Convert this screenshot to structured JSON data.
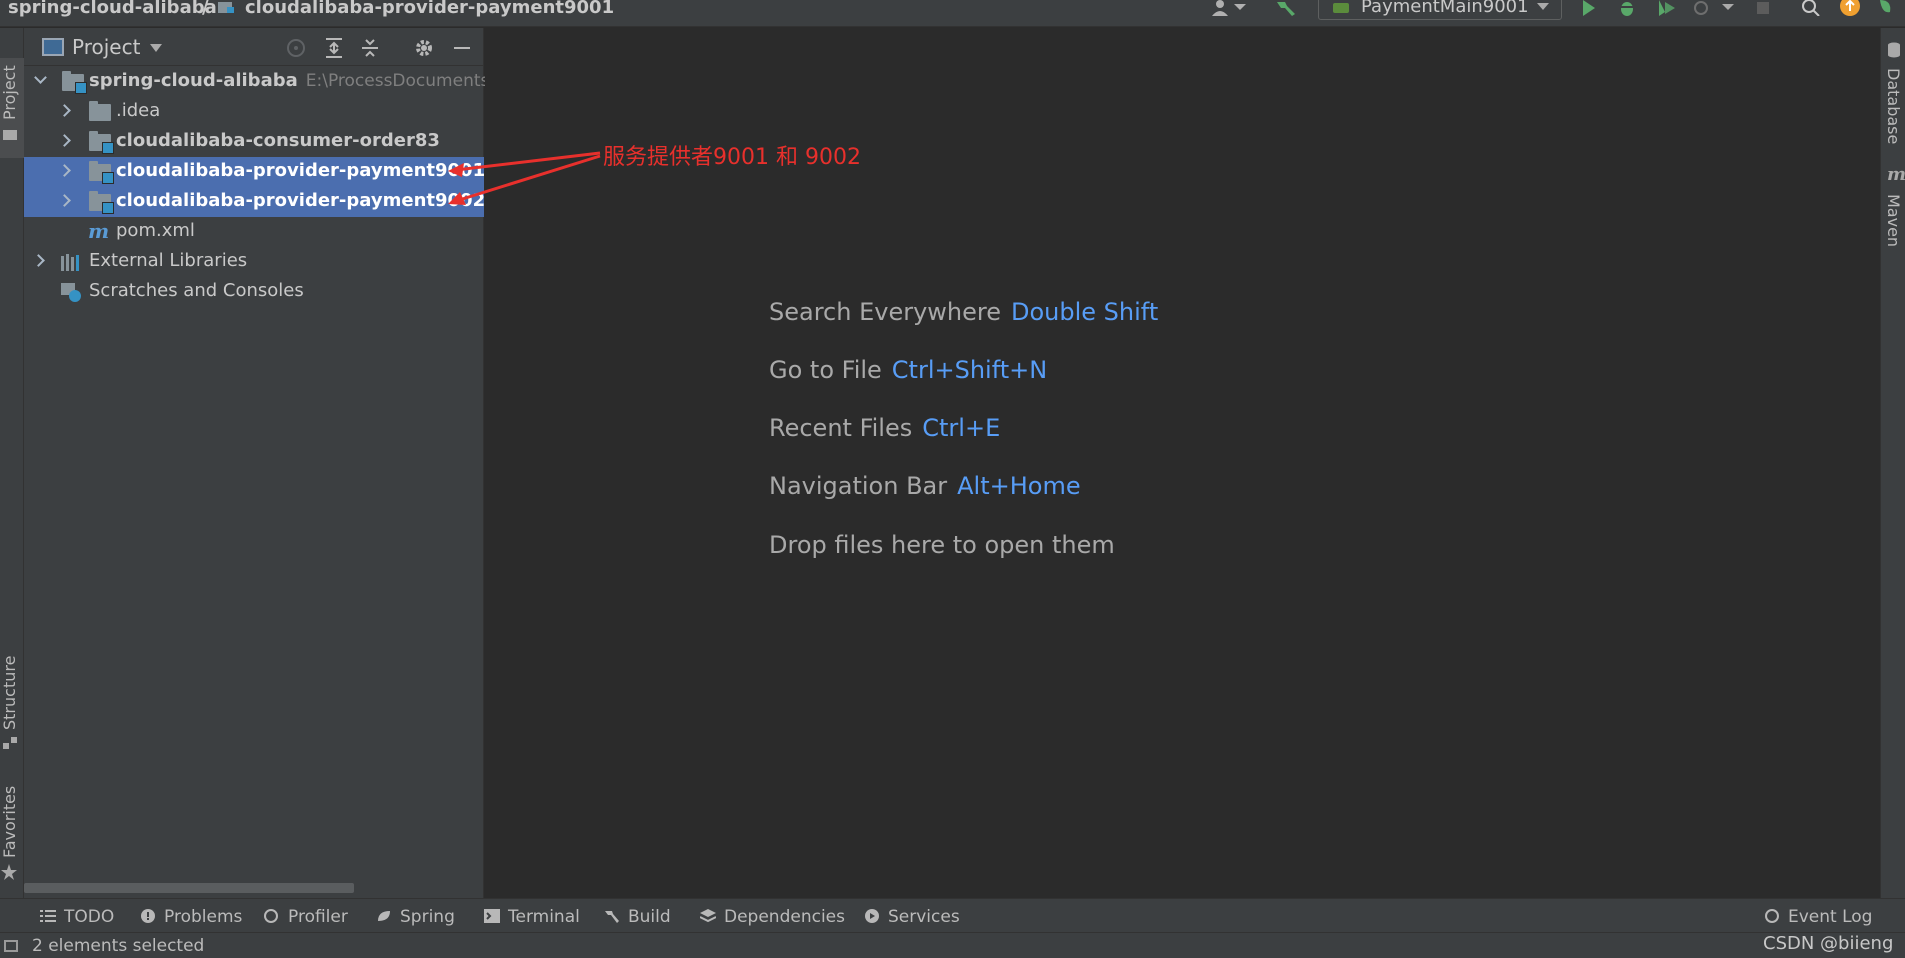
{
  "breadcrumb": {
    "root": "spring-cloud-alibaba",
    "separator": "/",
    "module": "cloudalibaba-provider-payment9001"
  },
  "toolbar": {
    "run_config": "PaymentMain9001"
  },
  "left_stripe": {
    "project": "Project",
    "structure": "Structure",
    "favorites": "Favorites"
  },
  "right_stripe": {
    "database": "Database",
    "maven": "Maven",
    "maven_icon_glyph": "m"
  },
  "project_panel": {
    "title": "Project",
    "tree": [
      {
        "label": "spring-cloud-alibaba",
        "path": "E:\\ProcessDocuments\\s",
        "expanded": true
      },
      {
        "label": ".idea"
      },
      {
        "label": "cloudalibaba-consumer-order83"
      },
      {
        "label": "cloudalibaba-provider-payment9001",
        "selected": true
      },
      {
        "label": "cloudalibaba-provider-payment9002",
        "selected": true
      },
      {
        "label": "pom.xml",
        "icon_glyph": "m"
      },
      {
        "label": "External Libraries"
      },
      {
        "label": "Scratches and Consoles"
      }
    ]
  },
  "editor_hints": [
    {
      "text": "Search Everywhere",
      "key": "Double Shift"
    },
    {
      "text": "Go to File",
      "key": "Ctrl+Shift+N"
    },
    {
      "text": "Recent Files",
      "key": "Ctrl+E"
    },
    {
      "text": "Navigation Bar",
      "key": "Alt+Home"
    },
    {
      "text": "Drop files here to open them",
      "key": ""
    }
  ],
  "annotation": {
    "text": "服务提供者9001 和 9002",
    "color": "#e8302c"
  },
  "bottom_tabs": [
    "TODO",
    "Problems",
    "Profiler",
    "Spring",
    "Terminal",
    "Build",
    "Dependencies",
    "Services"
  ],
  "event_log": "Event Log",
  "status": {
    "text": "2 elements selected",
    "watermark": "CSDN @biieng"
  },
  "colors": {
    "selection": "#4b6eaf",
    "key_blue": "#589df6",
    "panel": "#3c3f41",
    "editor": "#2b2b2b"
  }
}
